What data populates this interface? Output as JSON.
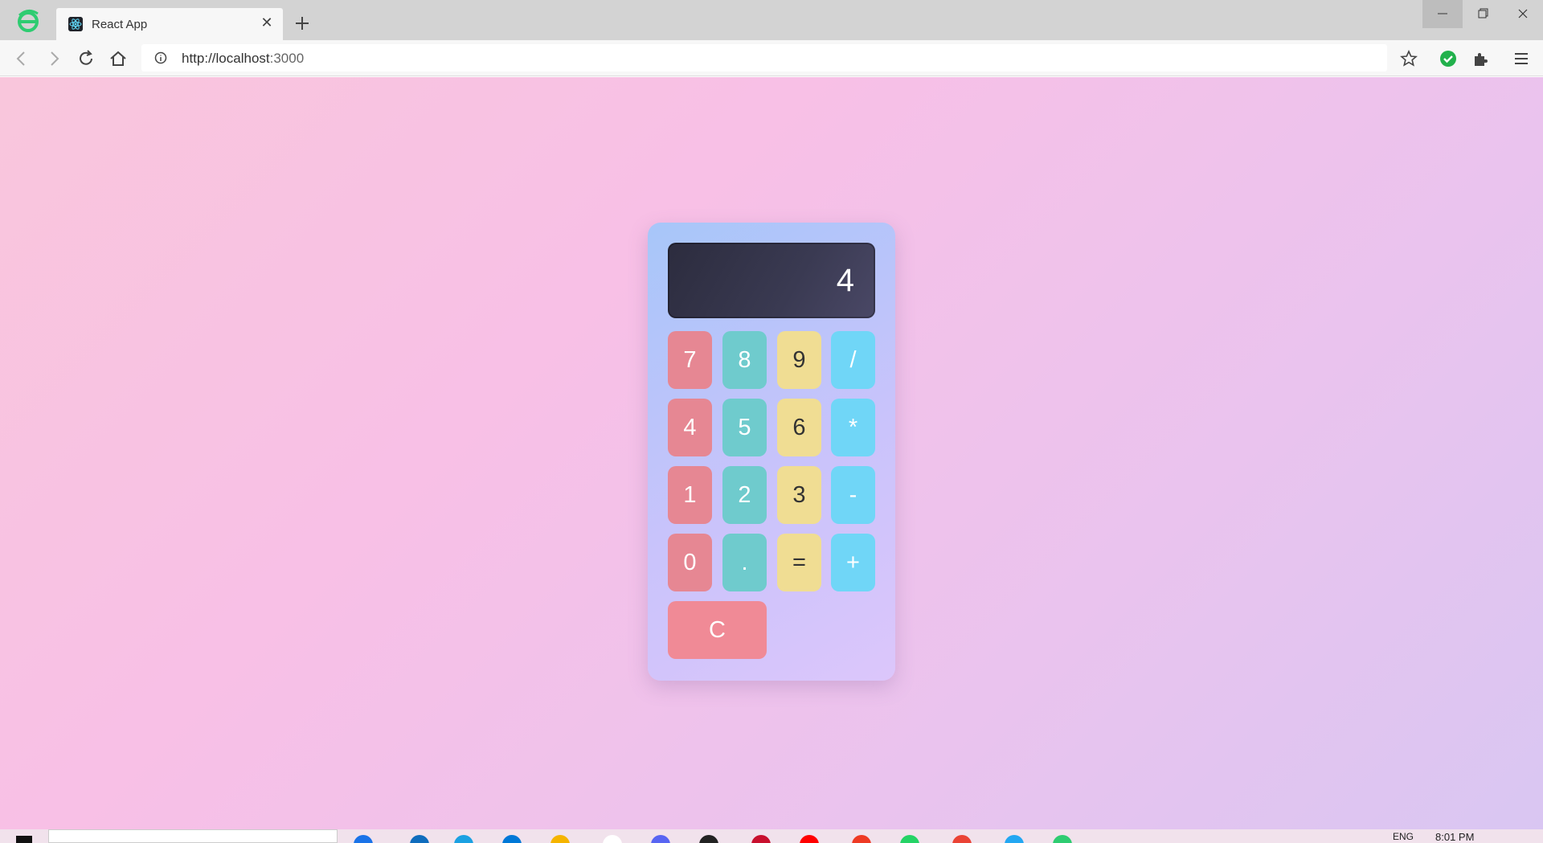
{
  "browser": {
    "tab_title": "React App",
    "tab_close": "✕",
    "url_host": "http://localhost",
    "url_port": ":3000"
  },
  "calculator": {
    "display": "4",
    "keys": [
      {
        "label": "7",
        "type": "number"
      },
      {
        "label": "8",
        "type": "number"
      },
      {
        "label": "9",
        "type": "number"
      },
      {
        "label": "/",
        "type": "operator"
      },
      {
        "label": "4",
        "type": "number"
      },
      {
        "label": "5",
        "type": "number"
      },
      {
        "label": "6",
        "type": "number"
      },
      {
        "label": "*",
        "type": "operator"
      },
      {
        "label": "1",
        "type": "number"
      },
      {
        "label": "2",
        "type": "number"
      },
      {
        "label": "3",
        "type": "number"
      },
      {
        "label": "-",
        "type": "operator"
      },
      {
        "label": "0",
        "type": "number"
      },
      {
        "label": ".",
        "type": "number"
      },
      {
        "label": "=",
        "type": "equals"
      },
      {
        "label": "+",
        "type": "operator"
      },
      {
        "label": "C",
        "type": "clear"
      }
    ]
  },
  "taskbar": {
    "language": "ENG",
    "time": "8:01 PM"
  },
  "colors": {
    "key_red": "#e68793",
    "key_teal": "#6fcbcd",
    "key_yellow": "#f0dd93",
    "key_blue": "#70d6f7",
    "display_bg": "#33334a"
  },
  "icons": [
    "browser-logo-icon",
    "react-favicon-icon",
    "close-icon",
    "plus-icon",
    "back-icon",
    "forward-icon",
    "reload-icon",
    "home-icon",
    "info-icon",
    "star-icon",
    "shield-check-icon",
    "extension-icon",
    "menu-icon"
  ]
}
